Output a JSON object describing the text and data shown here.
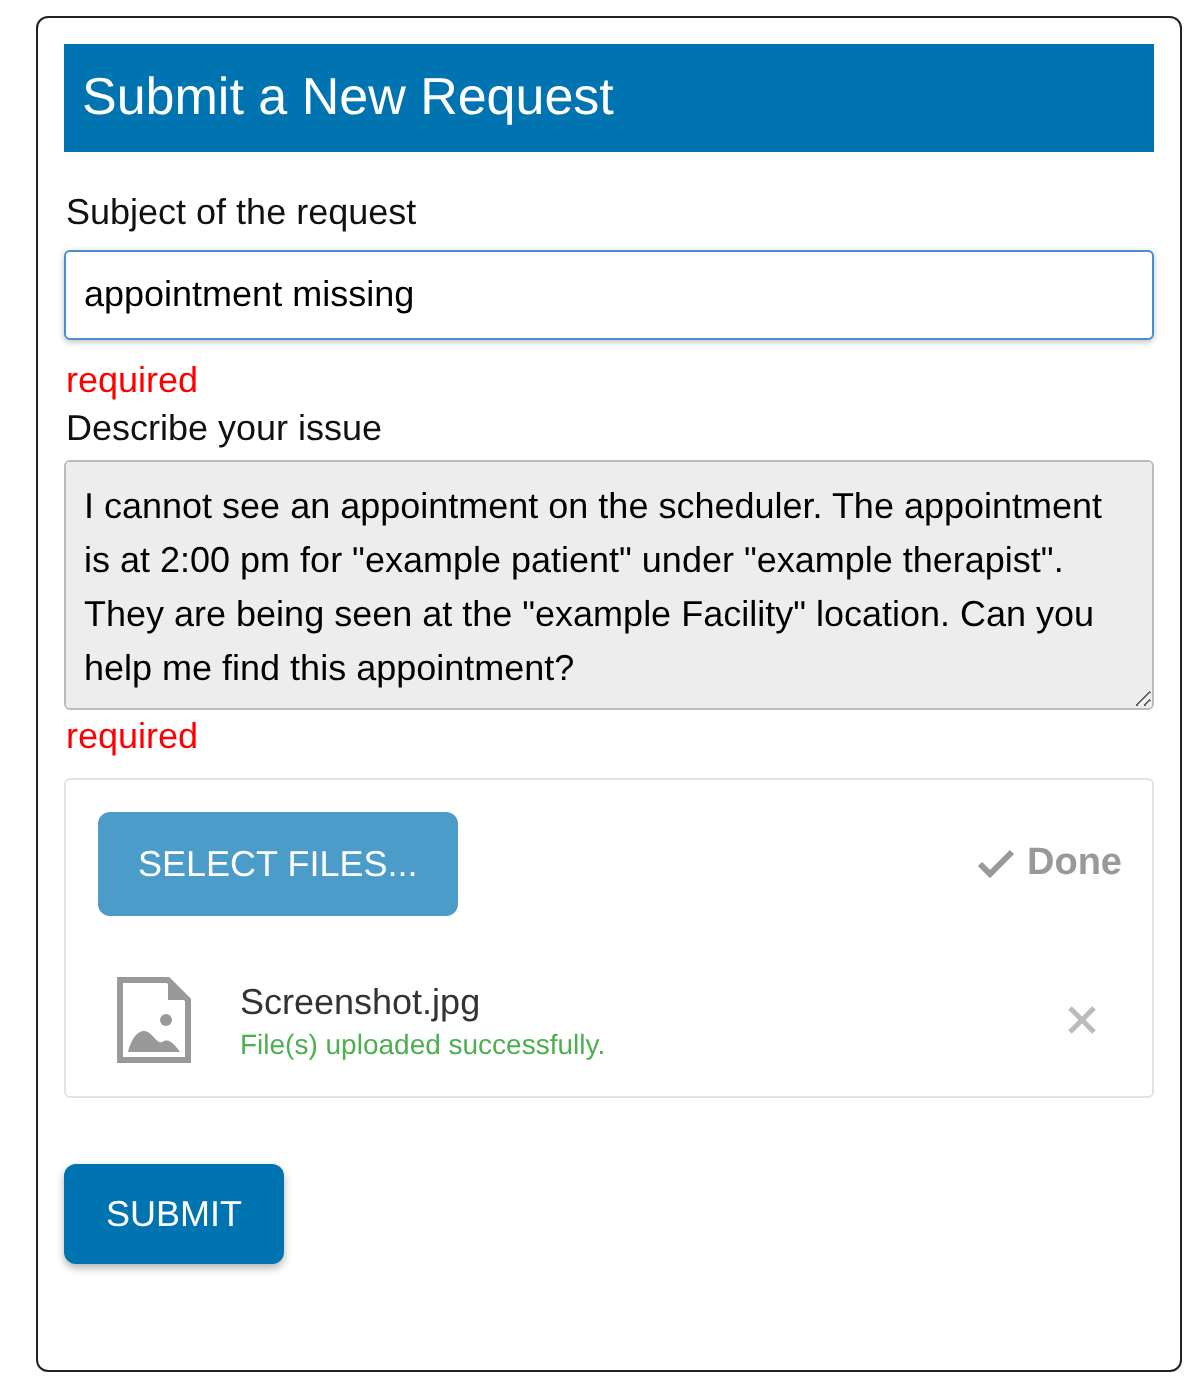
{
  "title": "Submit a New Request",
  "subject": {
    "label": "Subject of the request",
    "value": "appointment missing",
    "error": "required"
  },
  "description": {
    "label": "Describe your issue",
    "value": "I cannot see an appointment on the scheduler. The appointment is at 2:00 pm for \"example patient\" under \"example therapist\". They are being seen at the \"example Facility\" location. Can you help me find this appointment?",
    "error": "required"
  },
  "upload": {
    "button": "SELECT FILES...",
    "status": "Done",
    "files": [
      {
        "name": "Screenshot.jpg",
        "message": "File(s) uploaded successfully."
      }
    ]
  },
  "submit": "SUBMIT"
}
